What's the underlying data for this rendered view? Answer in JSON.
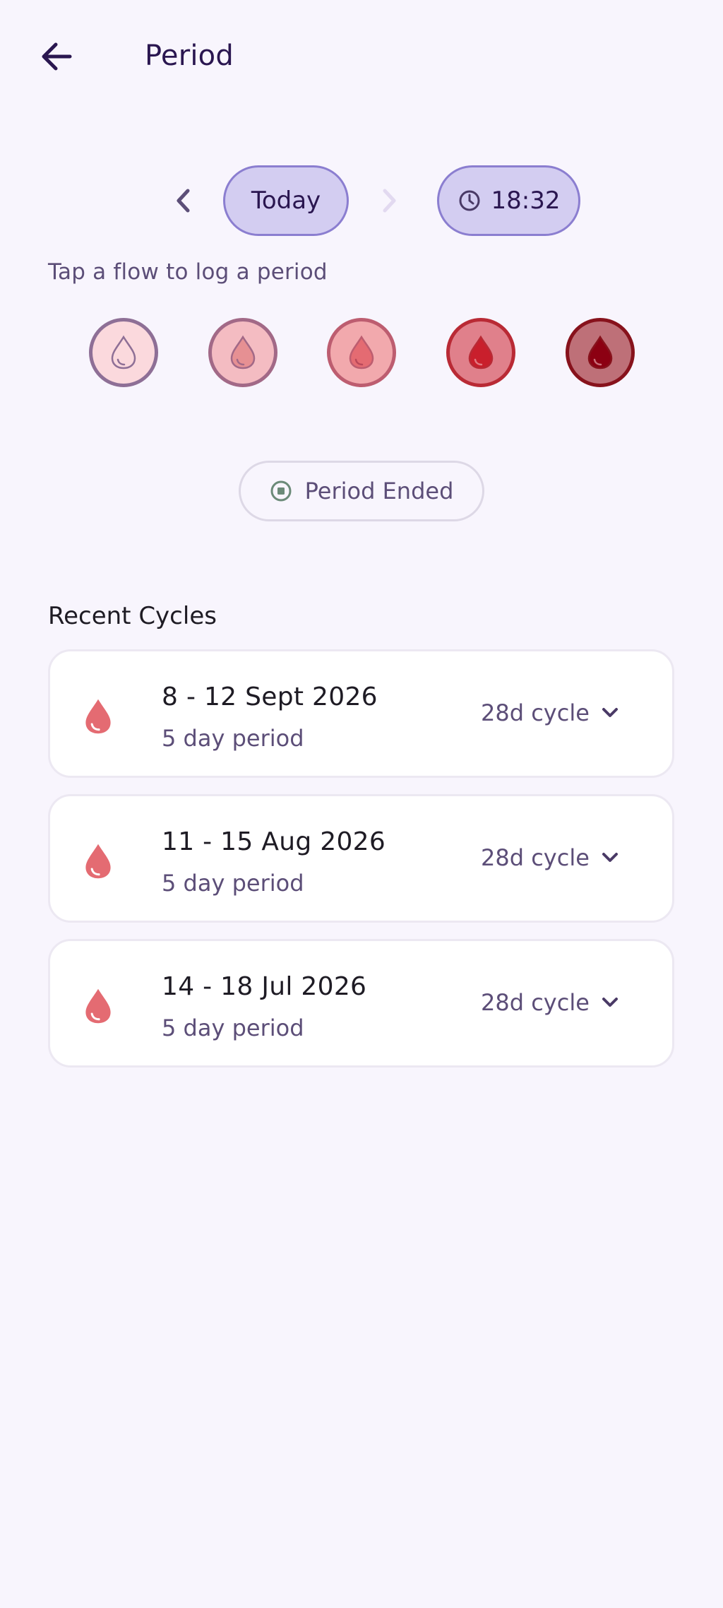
{
  "header": {
    "title": "Period",
    "back_icon": "arrow-left-icon"
  },
  "date_nav": {
    "prev_icon": "chevron-left-icon",
    "today_label": "Today",
    "next_icon": "chevron-right-icon",
    "time_icon": "clock-icon",
    "time_value": "18:32"
  },
  "hint": "Tap a flow to log a period",
  "flows": [
    {
      "icon": "drop-outline-icon",
      "bg": "#fbd9dd",
      "border": "#8e6f96",
      "drop": "#fbd9dd"
    },
    {
      "icon": "drop-icon",
      "bg": "#f4bcc2",
      "border": "#a26987",
      "drop": "#e69093"
    },
    {
      "icon": "drop-icon",
      "bg": "#f2a9ad",
      "border": "#bd5d70",
      "drop": "#e46b72"
    },
    {
      "icon": "drop-icon",
      "bg": "#e0808b",
      "border": "#b92a35",
      "drop": "#c91f2c"
    },
    {
      "icon": "drop-icon",
      "bg": "#be7078",
      "border": "#87121c",
      "drop": "#8c0012"
    }
  ],
  "ended": {
    "icon": "stop-circle-icon",
    "label": "Period Ended"
  },
  "recent": {
    "title": "Recent Cycles",
    "cycles": [
      {
        "dates": "8 - 12 Sept 2026",
        "length": "5 day period",
        "cycle": "28d cycle"
      },
      {
        "dates": "11 - 15 Aug 2026",
        "length": "5 day period",
        "cycle": "28d cycle"
      },
      {
        "dates": "14 - 18 Jul 2026",
        "length": "5 day period",
        "cycle": "28d cycle"
      }
    ]
  },
  "colors": {
    "background": "#f8f5fd",
    "accent_pill": "#d3cdf1",
    "accent_border": "#8b7ed0",
    "text_primary": "#2a1650",
    "text_secondary": "#5c4e78",
    "cycle_drop": "#e46b72"
  }
}
